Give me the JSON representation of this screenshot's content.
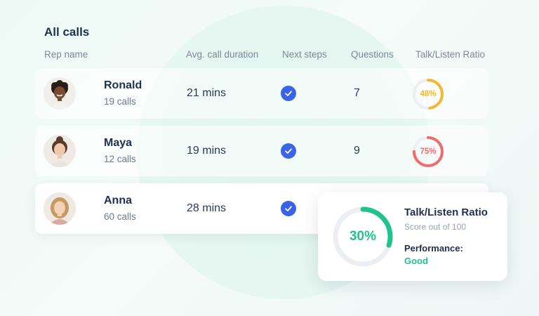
{
  "title": "All calls",
  "headers": {
    "rep_name": "Rep name",
    "avg_duration": "Avg. call duration",
    "next_steps": "Next steps",
    "questions": "Questions",
    "talk_listen": "Talk/Listen Ratio"
  },
  "reps": [
    {
      "name": "Ronald",
      "calls": "19 calls",
      "duration": "21 mins",
      "next_steps_done": true,
      "questions": "7",
      "ratio": 48,
      "ratio_label": "48%",
      "ratio_color": "#f5b733"
    },
    {
      "name": "Maya",
      "calls": "12 calls",
      "duration": "19 mins",
      "next_steps_done": true,
      "questions": "9",
      "ratio": 75,
      "ratio_label": "75%",
      "ratio_color": "#f26b6b"
    },
    {
      "name": "Anna",
      "calls": "60 calls",
      "duration": "28 mins",
      "next_steps_done": true
    }
  ],
  "detail_card": {
    "title": "Talk/Listen Ratio",
    "subtitle": "Score out of 100",
    "score": 30,
    "score_label": "30%",
    "performance_label": "Performance:",
    "performance_value": "Good",
    "accent_color": "#21c38a"
  },
  "colors": {
    "check": "#3a63e8",
    "ring_track": "#eceef1"
  }
}
